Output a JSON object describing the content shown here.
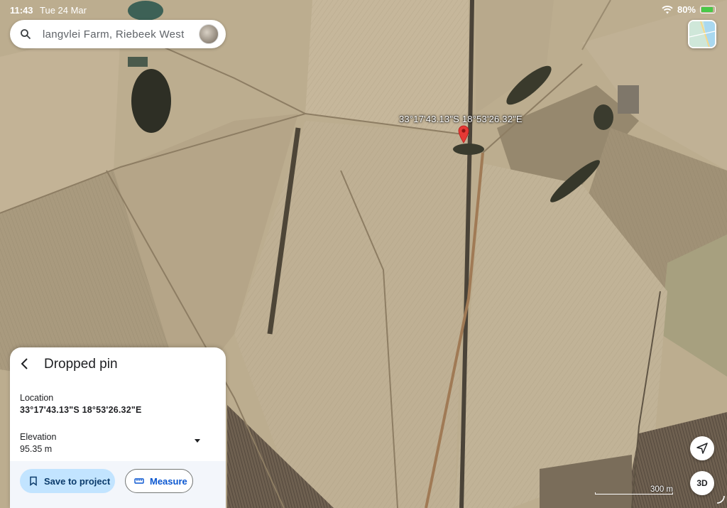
{
  "status_bar": {
    "time": "11:43",
    "date": "Tue 24 Mar",
    "battery": "80%",
    "battery_level": 0.8
  },
  "search": {
    "value": "langvlei Farm, Riebeek West"
  },
  "map": {
    "coordinate_label": "33°17'43.13\"S 18°53'26.32\"E",
    "scale_label": "300 m",
    "pin_color": "#e53935"
  },
  "panel": {
    "title": "Dropped pin",
    "location_label": "Location",
    "location_value": "33°17'43.13\"S 18°53'26.32\"E",
    "elevation_label": "Elevation",
    "elevation_value": "95.35 m",
    "save_label": "Save to project",
    "measure_label": "Measure"
  },
  "buttons": {
    "three_d_label": "3D"
  },
  "icons": {
    "search": "search-icon",
    "back": "back-arrow-icon",
    "bookmark": "bookmark-icon",
    "ruler": "ruler-icon",
    "navigate": "navigation-arrow-icon",
    "layers": "map-layers-icon",
    "dropdown": "caret-down-icon"
  },
  "colors": {
    "save_button_bg": "#c2e4ff",
    "measure_text": "#0b57d0",
    "terrain": "#b9a98b"
  }
}
